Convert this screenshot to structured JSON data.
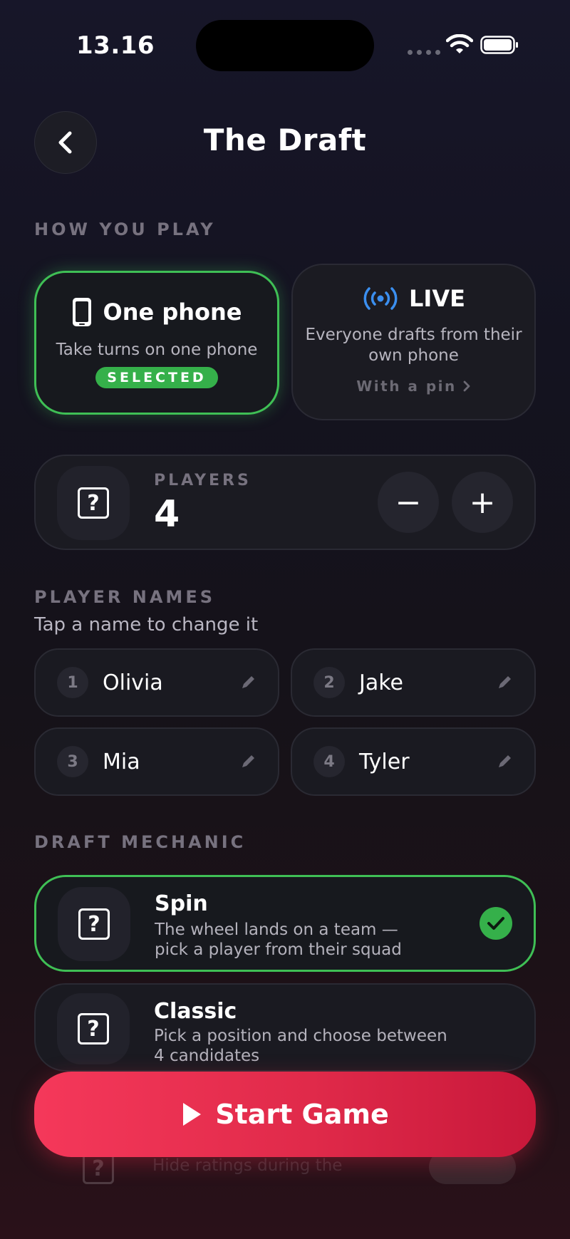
{
  "status_bar": {
    "time": "13.16"
  },
  "header": {
    "title": "The Draft"
  },
  "how_you_play": {
    "label": "HOW YOU PLAY",
    "one_phone": {
      "title": "One phone",
      "desc": "Take turns on one phone",
      "badge": "SELECTED"
    },
    "live": {
      "title": "LIVE",
      "desc_line1": "Everyone drafts from their",
      "desc_line2": "own phone",
      "link": "With a pin"
    }
  },
  "players": {
    "label": "PLAYERS",
    "count": "4",
    "minus": "−",
    "plus": "+"
  },
  "player_names": {
    "label": "PLAYER NAMES",
    "hint": "Tap a name to change it",
    "items": [
      {
        "num": "1",
        "name": "Olivia"
      },
      {
        "num": "2",
        "name": "Jake"
      },
      {
        "num": "3",
        "name": "Mia"
      },
      {
        "num": "4",
        "name": "Tyler"
      }
    ]
  },
  "draft_mechanic": {
    "label": "DRAFT MECHANIC",
    "items": [
      {
        "title": "Spin",
        "desc_line1": "The wheel lands on a team —",
        "desc_line2": "pick a player from their squad",
        "selected": true
      },
      {
        "title": "Classic",
        "desc_line1": "Pick a position and choose between",
        "desc_line2": "4 candidates",
        "selected": false
      }
    ],
    "hidden_item_desc": "Hide ratings during the"
  },
  "start": {
    "label": "Start Game"
  },
  "colors": {
    "accent_green": "#3fbf55",
    "start_red": "#e02a4a",
    "live_blue": "#3b8ff0"
  }
}
